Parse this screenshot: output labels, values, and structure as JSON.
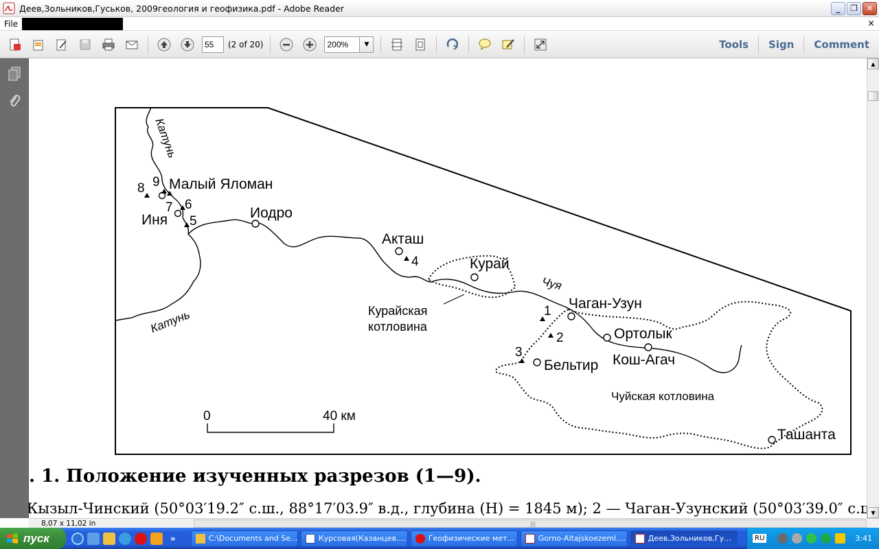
{
  "window": {
    "title": "Деев,Зольников,Гуськов, 2009геология и геофизика.pdf - Adobe Reader",
    "minimize": "_",
    "maximize": "❐",
    "close": "✕"
  },
  "menu": {
    "file": "File",
    "close_doc": "×"
  },
  "toolbar": {
    "page_value": "55",
    "page_of": "(2 of 20)",
    "zoom_value": "200%",
    "tools": "Tools",
    "sign": "Sign",
    "comment": "Comment"
  },
  "map": {
    "places": {
      "maly_yaloman": "Малый Яломан",
      "inya": "Иня",
      "iodro": "Иодро",
      "aktash": "Акташ",
      "kuray": "Курай",
      "chagan_uzun": "Чаган-Узун",
      "ortolyk": "Ортолык",
      "kosh_agach": "Кош-Агач",
      "beltir": "Бельтир",
      "tashanta": "Ташанта"
    },
    "basins": {
      "kuray_basin_1": "Курайская",
      "kuray_basin_2": "котловина",
      "chuy_basin": "Чуйская котловина"
    },
    "rivers": {
      "katun_top": "Катунь",
      "katun_bottom": "Катунь",
      "chuya": "Чуя"
    },
    "section_numbers": [
      "1",
      "2",
      "3",
      "4",
      "5",
      "6",
      "7",
      "8",
      "9"
    ],
    "scale": {
      "zero": "0",
      "end": "40 км"
    }
  },
  "caption": {
    "title": ". 1. Положение изученных разрезов (1—9).",
    "line2": "Кызыл-Чинский (50°03′19.2″ с.ш., 88°17′03.9″ в.д., глубина (H) = 1845 м); 2 — Чаган-Узунский (50°03′39.0″ с.ш."
  },
  "status": {
    "page_size": "8,07 x 11,02 in"
  },
  "taskbar": {
    "start": "пуск",
    "tasks": [
      "C:\\Documents and Se...",
      "Курсовая(Казанцев....",
      "Геофизические мет...",
      "Gorno-Altajskoezeml....",
      "Деев,Зольников,Гу..."
    ],
    "lang": "RU",
    "clock": "3:41",
    "more": "»"
  }
}
